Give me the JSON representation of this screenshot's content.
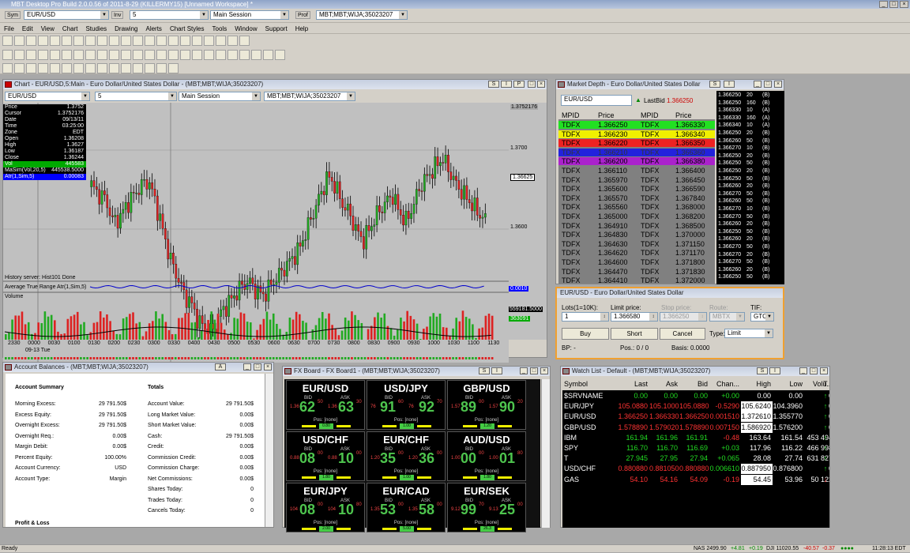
{
  "app": {
    "title": "MBT Desktop Pro Build 2.0.0.56 of 2011-8-29  (KILLERMY15)  [Unnamed Workspace] *",
    "symbol_box": "EUR/USD",
    "interval_box": "5",
    "session_box": "Main Session",
    "route_box": "MBT;MBT;WIJA;35023207",
    "sym_lbl": "Sym",
    "inv_lbl": "Inv",
    "prof_lbl": "Prof"
  },
  "menu": [
    "File",
    "Edit",
    "View",
    "Chart",
    "Studies",
    "Drawing",
    "Alerts",
    "Chart Styles",
    "Tools",
    "Window",
    "Support",
    "Help"
  ],
  "chart": {
    "title": "Chart - EUR/USD,5:Main - Euro Dollar/United States Dollar - (MBT;MBT;WIJA;35023207)",
    "symbol": "EUR/USD",
    "interval": "5",
    "session": "Main Session",
    "route": "MBT;MBT;WIJA;35023207",
    "cursor_price": "1.3752176",
    "last_price": "1.36625",
    "history": "History server: Hist101 Done",
    "atr_label": "Average True Range Atr(1,Sim,5)",
    "atr_value": "0.0010",
    "vol_label": "Volume",
    "vol_ma": "559181.5000",
    "vol_last": "363091",
    "price_axis": [
      {
        "label": "1.3700",
        "v": 1.37
      },
      {
        "label": "1.3600",
        "v": 1.36
      }
    ],
    "time_axis": [
      "2330",
      "0000",
      "0030",
      "0100",
      "0130",
      "0200",
      "0230",
      "0300",
      "0330",
      "0400",
      "0430",
      "0500",
      "0530",
      "0600",
      "0630",
      "0700",
      "0730",
      "0800",
      "0830",
      "0900",
      "0930",
      "1000",
      "1030",
      "1100",
      "1130"
    ],
    "date_label": "09-13 Tue",
    "info": [
      {
        "k": "Price",
        "v": "1.3752"
      },
      {
        "k": "Cursor",
        "v": "1.3752176"
      },
      {
        "k": "Date",
        "v": "09/13/11"
      },
      {
        "k": "Time",
        "v": "03:25:00"
      },
      {
        "k": "Zone",
        "v": "EDT"
      },
      {
        "k": "Open",
        "v": "1.36208"
      },
      {
        "k": "High",
        "v": "1.3627"
      },
      {
        "k": "Low",
        "v": "1.36187"
      },
      {
        "k": "Close",
        "v": "1.36244"
      },
      {
        "k": "Vol",
        "v": "445583"
      },
      {
        "k": "MaSim(Vol,20,5)",
        "v": "445538.5000"
      },
      {
        "k": "Atr(1,Sim,5)",
        "v": "0.00083"
      }
    ]
  },
  "depth": {
    "title": "Market Depth - Euro Dollar/United States Dollar",
    "symbol": "EUR/USD",
    "last_bid_label": "LastBid",
    "last_bid": "1.366250",
    "headers": [
      "MPID",
      "Price",
      "MPID",
      "Price"
    ],
    "rows": [
      [
        "TDFX",
        "1.366250",
        "TDFX",
        "1.366330"
      ],
      [
        "TDFX",
        "1.366230",
        "TDFX",
        "1.366340"
      ],
      [
        "TDFX",
        "1.366220",
        "TDFX",
        "1.366350"
      ],
      [
        "TDFX",
        "1.366210",
        "TDFX",
        "1.366360"
      ],
      [
        "TDFX",
        "1.366200",
        "TDFX",
        "1.366380"
      ],
      [
        "TDFX",
        "1.366110",
        "TDFX",
        "1.366400"
      ],
      [
        "TDFX",
        "1.365970",
        "TDFX",
        "1.366450"
      ],
      [
        "TDFX",
        "1.365600",
        "TDFX",
        "1.366590"
      ],
      [
        "TDFX",
        "1.365570",
        "TDFX",
        "1.367840"
      ],
      [
        "TDFX",
        "1.365560",
        "TDFX",
        "1.368000"
      ],
      [
        "TDFX",
        "1.365000",
        "TDFX",
        "1.368200"
      ],
      [
        "TDFX",
        "1.364910",
        "TDFX",
        "1.368500"
      ],
      [
        "TDFX",
        "1.364830",
        "TDFX",
        "1.370000"
      ],
      [
        "TDFX",
        "1.364630",
        "TDFX",
        "1.371150"
      ],
      [
        "TDFX",
        "1.364620",
        "TDFX",
        "1.371170"
      ],
      [
        "TDFX",
        "1.364600",
        "TDFX",
        "1.371800"
      ],
      [
        "TDFX",
        "1.364470",
        "TDFX",
        "1.371830"
      ],
      [
        "TDFX",
        "1.364410",
        "TDFX",
        "1.372000"
      ]
    ],
    "row_colors": [
      "#22e022",
      "#f0f000",
      "#ee2222",
      "#2222dd",
      "#aa22cc"
    ],
    "tape": [
      [
        "1.366250",
        "20",
        "(B)"
      ],
      [
        "1.366250",
        "160",
        "(B)"
      ],
      [
        "1.366330",
        "10",
        "(A)"
      ],
      [
        "1.366330",
        "160",
        "(A)"
      ],
      [
        "1.366340",
        "10",
        "(A)"
      ],
      [
        "1.366250",
        "20",
        "(B)"
      ],
      [
        "1.366260",
        "50",
        "(B)"
      ],
      [
        "1.366270",
        "10",
        "(B)"
      ],
      [
        "1.366250",
        "20",
        "(B)"
      ],
      [
        "1.366250",
        "50",
        "(B)"
      ],
      [
        "1.366250",
        "20",
        "(B)"
      ],
      [
        "1.366250",
        "50",
        "(B)"
      ],
      [
        "1.366260",
        "20",
        "(B)"
      ],
      [
        "1.366270",
        "50",
        "(B)"
      ],
      [
        "1.366260",
        "50",
        "(B)"
      ],
      [
        "1.366270",
        "10",
        "(B)"
      ],
      [
        "1.366270",
        "50",
        "(B)"
      ],
      [
        "1.366260",
        "20",
        "(B)"
      ],
      [
        "1.366250",
        "50",
        "(B)"
      ],
      [
        "1.366260",
        "20",
        "(B)"
      ],
      [
        "1.366270",
        "50",
        "(B)"
      ],
      [
        "1.366270",
        "20",
        "(B)"
      ],
      [
        "1.366270",
        "50",
        "(B)"
      ],
      [
        "1.366260",
        "20",
        "(B)"
      ],
      [
        "1.366250",
        "50",
        "(B)"
      ]
    ]
  },
  "order": {
    "title": "EUR/USD - Euro Dollar/United States Dollar",
    "lots_label": "Lots(1=10K):",
    "lots": "1",
    "limit_label": "Limit price:",
    "limit": "1.366580",
    "stop_label": "Stop price:",
    "stop": "1.366250",
    "route_label": "Route:",
    "route": "MBTX",
    "tif_label": "TIF:",
    "tif": "GTC",
    "buy": "Buy",
    "short": "Short",
    "cancel": "Cancel",
    "type_label": "Type:",
    "type": "Limit",
    "bp": "BP: -",
    "pos": "Pos.: 0 / 0",
    "basis": "Basis: 0.0000"
  },
  "account": {
    "title": "Account Balances - (MBT;MBT;WIJA;35023207)",
    "summary_title": "Account Summary",
    "totals_title": "Totals",
    "left": [
      [
        "Morning Excess:",
        "29 791.50$"
      ],
      [
        "Excess Equity:",
        "29 791.50$"
      ],
      [
        "Overnight Excess:",
        "29 791.50$"
      ],
      [
        "Overnight Req.:",
        "0.00$"
      ],
      [
        "Margin Debit:",
        "0.00$"
      ],
      [
        "Percent Equity:",
        "100.00%"
      ],
      [
        "Account Currency:",
        "USD"
      ],
      [
        "Account Type:",
        "Margin"
      ]
    ],
    "right": [
      [
        "Account Value:",
        "29 791.50$"
      ],
      [
        "Long Market Value:",
        "0.00$"
      ],
      [
        "Short Market Value:",
        "0.00$"
      ],
      [
        "Cash:",
        "29 791.50$"
      ],
      [
        "Credit:",
        "0.00$"
      ],
      [
        "Commission Credit:",
        "0.00$"
      ],
      [
        "Commission Charge:",
        "0.00$"
      ],
      [
        "Net Commissions:",
        "0.00$"
      ],
      [
        "Shares Today:",
        "0"
      ],
      [
        "Trades Today:",
        "0"
      ],
      [
        "Cancels Today:",
        "0"
      ]
    ],
    "pl_title": "Profit & Loss"
  },
  "fx": {
    "title": "FX Board - FX Board1 - (MBT;MBT;WIJA;35023207)",
    "bid_lbl": "BID",
    "ask_lbl": "ASK",
    "pos": "Pos: [none]",
    "cells": [
      {
        "pair": "EUR/USD",
        "bid_sm": "1.36",
        "bid": "62",
        "bid_x": "50",
        "ask_sm": "1.36",
        "ask": "63",
        "ask_x": "30",
        "sp": "0.80"
      },
      {
        "pair": "USD/JPY",
        "bid_sm": "76",
        "bid": "91",
        "bid_x": "60",
        "ask_sm": "76",
        "ask": "92",
        "ask_x": "70",
        "sp": "1.00"
      },
      {
        "pair": "GBP/USD",
        "bid_sm": "1.57",
        "bid": "89",
        "bid_x": "00",
        "ask_sm": "1.57",
        "ask": "90",
        "ask_x": "20",
        "sp": "1.20"
      },
      {
        "pair": "USD/CHF",
        "bid_sm": "0.88",
        "bid": "08",
        "bid_x": "00",
        "ask_sm": "0.88",
        "ask": "10",
        "ask_x": "00",
        "sp": "1.80"
      },
      {
        "pair": "EUR/CHF",
        "bid_sm": "1.20",
        "bid": "35",
        "bid_x": "00",
        "ask_sm": "1.20",
        "ask": "36",
        "ask_x": "00",
        "sp": "1.00"
      },
      {
        "pair": "AUD/USD",
        "bid_sm": "1.00",
        "bid": "00",
        "bid_x": "00",
        "ask_sm": "1.00",
        "ask": "01",
        "ask_x": "80",
        "sp": "1.80"
      },
      {
        "pair": "EUR/JPY",
        "bid_sm": "104",
        "bid": "08",
        "bid_x": "00",
        "ask_sm": "104",
        "ask": "10",
        "ask_x": "80",
        "sp": "2.00"
      },
      {
        "pair": "EUR/CAD",
        "bid_sm": "1.35",
        "bid": "53",
        "bid_x": "00",
        "ask_sm": "1.35",
        "ask": "58",
        "ask_x": "00",
        "sp": "5.00"
      },
      {
        "pair": "EUR/SEK",
        "bid_sm": "9.12",
        "bid": "99",
        "bid_x": "70",
        "ask_sm": "9.13",
        "ask": "25",
        "ask_x": "00",
        "sp": "26.3"
      }
    ]
  },
  "watch": {
    "title": "Watch List - Default - (MBT;MBT;WIJA;35023207)",
    "headers": [
      "Symbol",
      "Last",
      "Ask",
      "Bid",
      "Chan...",
      "High",
      "Low",
      "Volu...",
      "T..."
    ],
    "rows": [
      {
        "c": [
          "$SRVNAME",
          "0.00",
          "0.00",
          "0.00",
          "+0.00",
          "0.00",
          "0.00",
          "0",
          "↑"
        ],
        "bg": "#000",
        "chg": "#22dd22"
      },
      {
        "c": [
          "EUR/JPY",
          "105.0880",
          "105.1000",
          "105.0880",
          "-0.5290",
          "105.6240",
          "104.3960",
          "0",
          "↑"
        ],
        "bg": "#000",
        "chg": "#ff3333",
        "hl": true
      },
      {
        "c": [
          "EUR/USD",
          "1.366250",
          "1.366330",
          "1.366250",
          "0.001510",
          "1.372610",
          "1.355770",
          "0",
          "↑"
        ],
        "bg": "#000",
        "chg": "#ff3333",
        "hl": true
      },
      {
        "c": [
          "GBP/USD",
          "1.578890",
          "1.579020",
          "1.578890",
          "0.007150",
          "1.586920",
          "1.576200",
          "0",
          "↑"
        ],
        "bg": "#000",
        "chg": "#ff3333",
        "hl": true
      },
      {
        "c": [
          "IBM",
          "161.94",
          "161.96",
          "161.91",
          "-0.48",
          "163.64",
          "161.54",
          "453 494",
          "↑"
        ],
        "bg": "#000",
        "chg": "#ff3333"
      },
      {
        "c": [
          "SPY",
          "116.70",
          "116.70",
          "116.69",
          "+0.03",
          "117.96",
          "116.22",
          "466 998",
          "↑"
        ],
        "bg": "#000",
        "chg": "#22dd22"
      },
      {
        "c": [
          "T",
          "27.945",
          "27.95",
          "27.94",
          "+0.065",
          "28.08",
          "27.74",
          "631 827",
          "↑"
        ],
        "bg": "#000",
        "chg": "#22dd22"
      },
      {
        "c": [
          "USD/CHF",
          "0.880880",
          "0.881050",
          "0.880880",
          "0.006610",
          "0.887950",
          "0.876800",
          "0",
          "↑"
        ],
        "bg": "#000",
        "chg": "#22dd22",
        "hl": true
      },
      {
        "c": [
          "GAS",
          "54.10",
          "54.16",
          "54.09",
          "-0.19",
          "54.45",
          "53.96",
          "50 122",
          "↓"
        ],
        "bg": "#000",
        "chg": "#ff3333",
        "hl": true
      }
    ]
  },
  "status": {
    "ready": "Ready",
    "nas": "NAS 2499.90",
    "nas_chg": "+4.81",
    "nas_pct": "+0.19",
    "dji": "DJI 11020.55",
    "dji_chg": "-40.57",
    "dji_pct": "-0.37",
    "time": "11:28:13 EDT"
  },
  "colors": {
    "up": "#22aa22",
    "down": "#dd2222",
    "panel_bg": "#d4d0c8"
  }
}
